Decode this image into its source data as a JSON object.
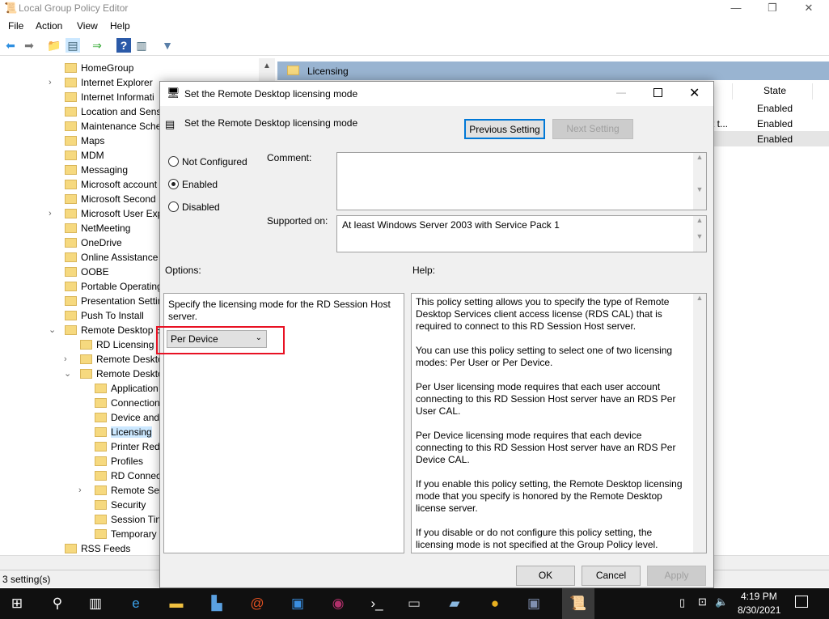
{
  "window": {
    "title": "Local Group Policy Editor",
    "controls": [
      "—",
      "❐",
      "✕"
    ]
  },
  "menu": [
    "File",
    "Action",
    "View",
    "Help"
  ],
  "toolbar": [
    "back",
    "forward",
    "up-folder",
    "show-hide-tree",
    "export-list",
    "help",
    "show-hide-action",
    "filter"
  ],
  "tree": [
    {
      "label": "HomeGroup",
      "level": 1,
      "chev": ""
    },
    {
      "label": "Internet Explorer",
      "level": 1,
      "chev": ">"
    },
    {
      "label": "Internet Informati",
      "level": 1,
      "chev": ""
    },
    {
      "label": "Location and Sens",
      "level": 1,
      "chev": ""
    },
    {
      "label": "Maintenance Sche",
      "level": 1,
      "chev": ""
    },
    {
      "label": "Maps",
      "level": 1,
      "chev": ""
    },
    {
      "label": "MDM",
      "level": 1,
      "chev": ""
    },
    {
      "label": "Messaging",
      "level": 1,
      "chev": ""
    },
    {
      "label": "Microsoft account",
      "level": 1,
      "chev": ""
    },
    {
      "label": "Microsoft Second",
      "level": 1,
      "chev": ""
    },
    {
      "label": "Microsoft User Exp",
      "level": 1,
      "chev": ">"
    },
    {
      "label": "NetMeeting",
      "level": 1,
      "chev": ""
    },
    {
      "label": "OneDrive",
      "level": 1,
      "chev": ""
    },
    {
      "label": "Online Assistance",
      "level": 1,
      "chev": ""
    },
    {
      "label": "OOBE",
      "level": 1,
      "chev": ""
    },
    {
      "label": "Portable Operating",
      "level": 1,
      "chev": ""
    },
    {
      "label": "Presentation Settin",
      "level": 1,
      "chev": ""
    },
    {
      "label": "Push To Install",
      "level": 1,
      "chev": ""
    },
    {
      "label": "Remote Desktop S",
      "level": 1,
      "chev": "v"
    },
    {
      "label": "RD Licensing",
      "level": 2,
      "chev": ""
    },
    {
      "label": "Remote Deskto",
      "level": 2,
      "chev": ">"
    },
    {
      "label": "Remote Deskto",
      "level": 2,
      "chev": "v"
    },
    {
      "label": "Application",
      "level": 3,
      "chev": ""
    },
    {
      "label": "Connection",
      "level": 3,
      "chev": ""
    },
    {
      "label": "Device and",
      "level": 3,
      "chev": ""
    },
    {
      "label": "Licensing",
      "level": 3,
      "chev": "",
      "selected": true
    },
    {
      "label": "Printer Red",
      "level": 3,
      "chev": ""
    },
    {
      "label": "Profiles",
      "level": 3,
      "chev": ""
    },
    {
      "label": "RD Connec",
      "level": 3,
      "chev": ""
    },
    {
      "label": "Remote Se",
      "level": 3,
      "chev": ">"
    },
    {
      "label": "Security",
      "level": 3,
      "chev": ""
    },
    {
      "label": "Session Tin",
      "level": 3,
      "chev": ""
    },
    {
      "label": "Temporary",
      "level": 3,
      "chev": ""
    },
    {
      "label": "RSS Feeds",
      "level": 1,
      "chev": ""
    }
  ],
  "right": {
    "header": "Licensing",
    "state_col": "State",
    "rows": [
      {
        "setting": "",
        "state": "Enabled"
      },
      {
        "setting": "t t...",
        "state": "Enabled"
      },
      {
        "setting": "",
        "state": "Enabled"
      }
    ]
  },
  "status": "3 setting(s)",
  "dialog": {
    "title": "Set the Remote Desktop licensing mode",
    "heading": "Set the Remote Desktop licensing mode",
    "prev": "Previous Setting",
    "next": "Next Setting",
    "radios": [
      {
        "label": "Not Configured",
        "checked": false
      },
      {
        "label": "Enabled",
        "checked": true
      },
      {
        "label": "Disabled",
        "checked": false
      }
    ],
    "comment_label": "Comment:",
    "comment_value": "",
    "supported_label": "Supported on:",
    "supported_value": "At least Windows Server 2003 with Service Pack 1",
    "options_label": "Options:",
    "help_label": "Help:",
    "options_text": "Specify the licensing mode for the RD Session Host server.",
    "mode_value": "Per Device",
    "help": [
      "This policy setting allows you to specify the type of Remote Desktop Services client access license (RDS CAL) that is required to connect to this RD Session Host server.",
      "You can use this policy setting to select one of two licensing modes: Per User or Per Device.",
      "Per User licensing mode requires that each user account connecting to this RD Session Host server have an RDS Per User CAL.",
      "Per Device licensing mode requires that each device connecting to this RD Session Host server have an RDS Per Device CAL.",
      "If you enable this policy setting, the Remote Desktop licensing mode that you specify is honored by the Remote Desktop license server.",
      "If you disable or do not configure this policy setting, the licensing mode is not specified at the Group Policy level."
    ],
    "ok": "OK",
    "cancel": "Cancel",
    "apply": "Apply",
    "highlight_color": "#e81123"
  },
  "taskbar": {
    "time": "4:19 PM",
    "date": "8/30/2021",
    "apps": [
      "start",
      "search",
      "task-view",
      "internet-explorer",
      "file-explorer",
      "server-manager",
      "app-red",
      "control-panel",
      "database",
      "powershell",
      "cmd",
      "notepad-app",
      "chrome",
      "network-app",
      "group-policy-editor"
    ]
  }
}
